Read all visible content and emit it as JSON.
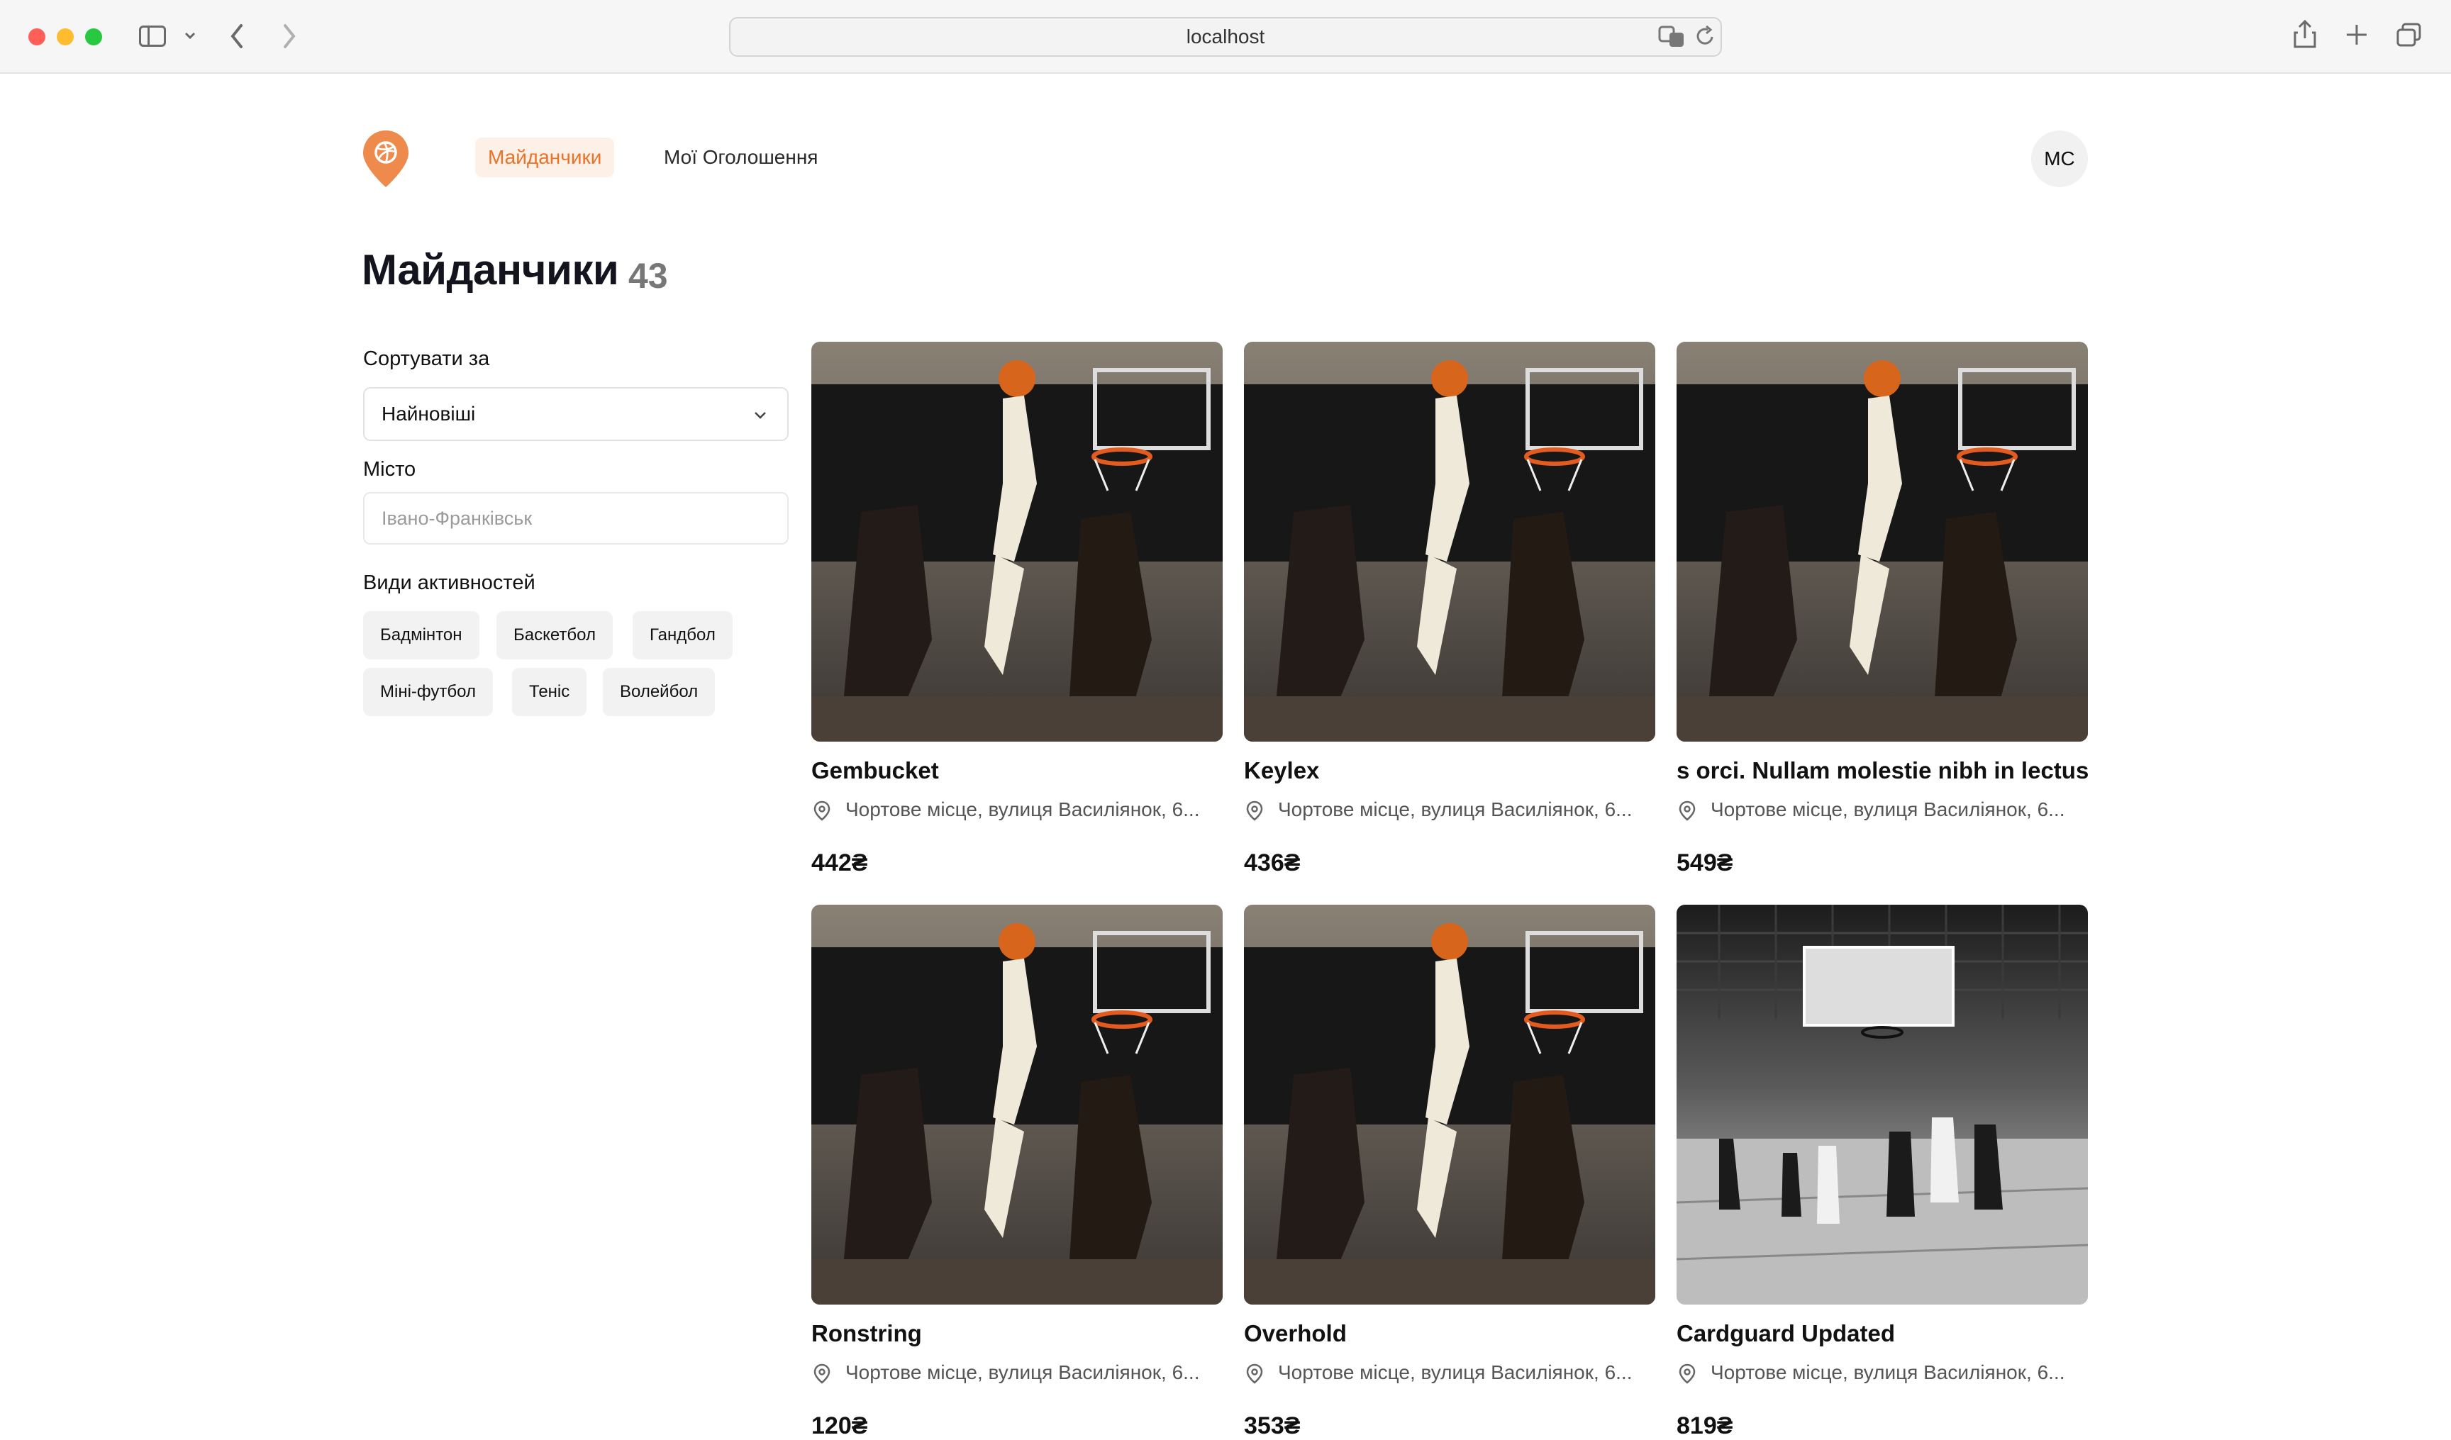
{
  "browser": {
    "url": "localhost"
  },
  "nav": {
    "items": [
      {
        "label": "Майданчики",
        "active": true
      },
      {
        "label": "Мої Оголошення",
        "active": false
      }
    ],
    "avatar_initials": "МС"
  },
  "header": {
    "title": "Майданчики",
    "count": "43"
  },
  "filters": {
    "sort_label": "Сортувати за",
    "sort_value": "Найновіші",
    "city_label": "Місто",
    "city_placeholder": "Івано-Франківськ",
    "activities_label": "Види активностей",
    "activities": [
      "Бадмінтон",
      "Баскетбол",
      "Гандбол",
      "Міні-футбол",
      "Теніс",
      "Волейбол"
    ]
  },
  "cards": [
    {
      "title": "Gembucket",
      "location": "Чортове місце, вулиця Василіянок, 6...",
      "price": "442₴",
      "image": "color"
    },
    {
      "title": "Keylex",
      "location": "Чортове місце, вулиця Василіянок, 6...",
      "price": "436₴",
      "image": "color"
    },
    {
      "title": "s orci. Nullam molestie nibh in lectus.",
      "location": "Чортове місце, вулиця Василіянок, 6...",
      "price": "549₴",
      "image": "color"
    },
    {
      "title": "Ronstring",
      "location": "Чортове місце, вулиця Василіянок, 6...",
      "price": "120₴",
      "image": "color"
    },
    {
      "title": "Overhold",
      "location": "Чортове місце, вулиця Василіянок, 6...",
      "price": "353₴",
      "image": "color"
    },
    {
      "title": "Cardguard Updated",
      "location": "Чортове місце, вулиця Василіянок, 6...",
      "price": "819₴",
      "image": "bw"
    }
  ],
  "colors": {
    "accent": "#e8742a",
    "accent_bg": "#fdf0e6"
  }
}
